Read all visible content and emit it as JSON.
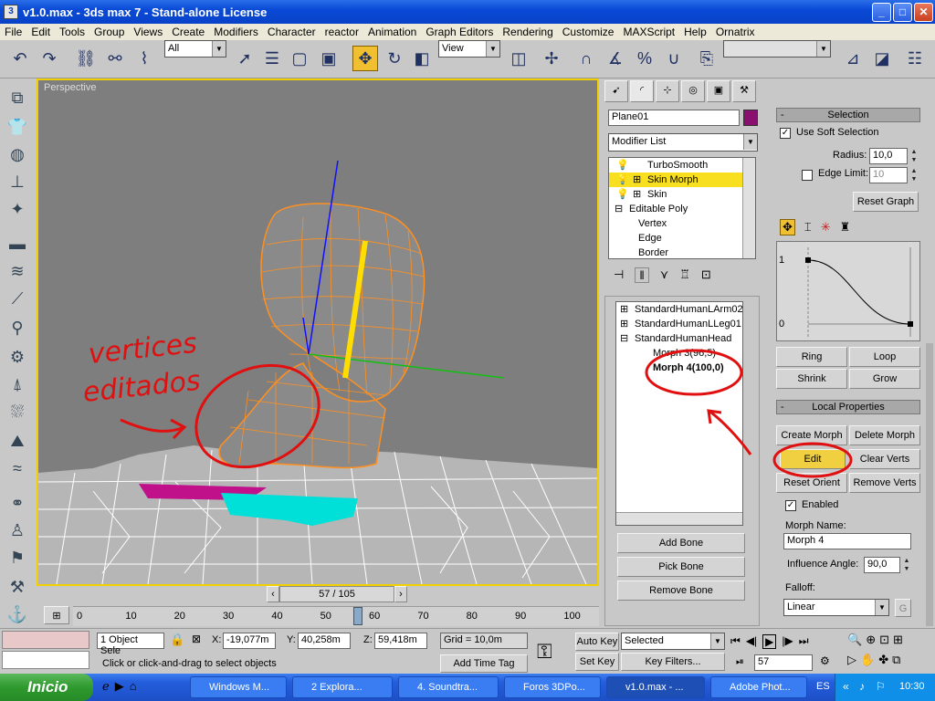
{
  "window": {
    "title": "v1.0.max - 3ds max 7 - Stand-alone License",
    "min": "_",
    "max": "□",
    "close": "✕"
  },
  "menu": [
    "File",
    "Edit",
    "Tools",
    "Group",
    "Views",
    "Create",
    "Modifiers",
    "Character",
    "reactor",
    "Animation",
    "Graph Editors",
    "Rendering",
    "Customize",
    "MAXScript",
    "Help",
    "Ornatrix"
  ],
  "toolbar": {
    "selection_filter": "All",
    "ref_coord": "View"
  },
  "viewport": {
    "label": "Perspective",
    "annotation_text_1": "vertices",
    "annotation_text_2": "editados"
  },
  "command_panel": {
    "object_name": "Plane01",
    "object_color": "#8a1070",
    "modifier_list_label": "Modifier List",
    "stack": [
      {
        "name": "TurboSmooth",
        "selected": false
      },
      {
        "name": "Skin Morph",
        "selected": true
      },
      {
        "name": "Skin",
        "selected": false
      },
      {
        "name": "Editable Poly",
        "selected": false
      },
      {
        "name": "Vertex",
        "selected": false
      },
      {
        "name": "Edge",
        "selected": false
      },
      {
        "name": "Border",
        "selected": false
      }
    ],
    "bones": [
      "StandardHumanLArm02",
      "StandardHumanLLeg01",
      "StandardHumanHead",
      "Morph 3(96,5)",
      "Morph 4(100,0)"
    ],
    "add_bone": "Add Bone",
    "pick_bone": "Pick Bone",
    "remove_bone": "Remove Bone"
  },
  "selection_rollout": {
    "header": "Selection",
    "use_soft_selection": "Use Soft Selection",
    "radius_label": "Radius:",
    "radius_value": "10,0",
    "edge_limit_label": "Edge Limit:",
    "edge_limit_value": "10",
    "reset_graph": "Reset Graph",
    "graph_y_top": "1",
    "graph_y_bottom": "0",
    "ring": "Ring",
    "loop": "Loop",
    "shrink": "Shrink",
    "grow": "Grow"
  },
  "local_properties": {
    "header": "Local Properties",
    "create_morph": "Create Morph",
    "delete_morph": "Delete Morph",
    "edit": "Edit",
    "clear_verts": "Clear Verts",
    "reset_orient": "Reset Orient",
    "remove_verts": "Remove Verts",
    "enabled": "Enabled",
    "morph_name_label": "Morph Name:",
    "morph_name_value": "Morph 4",
    "influence_label": "Influence Angle:",
    "influence_value": "90,0",
    "falloff_label": "Falloff:",
    "falloff_value": "Linear",
    "g_button": "G"
  },
  "time": {
    "slider_label": "57 / 105",
    "current_frame": 57,
    "total_frames": 105,
    "ticks": [
      "0",
      "10",
      "20",
      "30",
      "40",
      "50",
      "60",
      "70",
      "80",
      "90",
      "100"
    ]
  },
  "status": {
    "selected_count": "1 Object Sele",
    "x": "-19,077m",
    "y": "40,258m",
    "z": "59,418m",
    "grid": "Grid = 10,0m",
    "prompt": "Click or click-and-drag to select objects",
    "add_time_tag": "Add Time Tag",
    "auto_key": "Auto Key",
    "set_key": "Set Key",
    "selected_dd": "Selected",
    "key_filters": "Key Filters...",
    "frame_field": "57"
  },
  "taskbar": {
    "start": "Inicio",
    "tasks": [
      "Windows M...",
      "2 Explora...",
      "4. Soundtra...",
      "Foros 3DPo...",
      "v1.0.max - ...",
      "Adobe Phot..."
    ],
    "lang": "ES",
    "clock": "10:30"
  }
}
